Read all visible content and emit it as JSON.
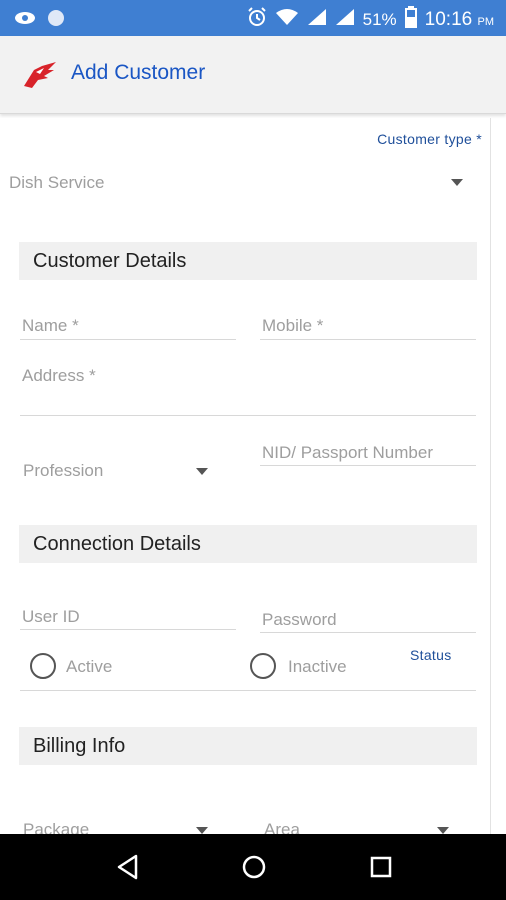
{
  "status_bar": {
    "battery": "51%",
    "time": "10:16",
    "ampm": "PM",
    "bg_color": "#3f7fd2"
  },
  "app_bar": {
    "title": "Add Customer",
    "logo_icon": "eagle-logo",
    "title_color": "#1a56c4"
  },
  "form": {
    "customer_type": {
      "label": "Customer type *",
      "value": "Dish Service"
    },
    "customer_details": {
      "header": "Customer Details",
      "name_placeholder": "Name *",
      "mobile_placeholder": "Mobile *",
      "address_placeholder": "Address *",
      "profession_placeholder": "Profession",
      "nid_placeholder": "NID/ Passport Number"
    },
    "connection_details": {
      "header": "Connection Details",
      "userid_placeholder": "User ID",
      "password_placeholder": "Password",
      "status_label": "Status",
      "active_label": "Active",
      "inactive_label": "Inactive"
    },
    "billing_info": {
      "header": "Billing Info",
      "package_placeholder": "Package",
      "area_placeholder": "Area"
    }
  },
  "nav_bar": {
    "back_icon": "back-triangle-icon",
    "home_icon": "home-circle-icon",
    "recents_icon": "recents-square-icon"
  }
}
